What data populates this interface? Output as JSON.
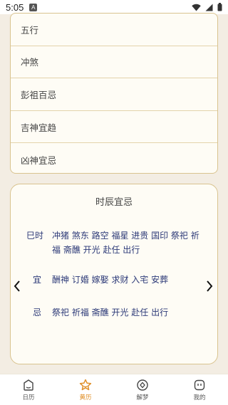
{
  "status_bar": {
    "time": "5:05",
    "notification_badge": "A"
  },
  "info_list": {
    "items": [
      {
        "label": "五行"
      },
      {
        "label": "冲煞"
      },
      {
        "label": "彭祖百忌"
      },
      {
        "label": "吉神宜趋"
      },
      {
        "label": "凶神宜忌"
      }
    ]
  },
  "shichen": {
    "title": "时辰宜忌",
    "hour_label": "巳时",
    "hour_text": "冲猪 煞东 路空 福星 进贵 国印 祭祀 祈福 斋醮 开光 赴任 出行",
    "yi_label": "宜",
    "yi_text": "酬神 订婚 嫁娶 求财 入宅 安葬",
    "ji_label": "忌",
    "ji_text": "祭祀 祈福 斋醮 开光 赴任 出行"
  },
  "tabs": [
    {
      "label": "日历",
      "icon": "calendar-icon",
      "active": false
    },
    {
      "label": "黄历",
      "icon": "star-icon",
      "active": true
    },
    {
      "label": "解梦",
      "icon": "dream-icon",
      "active": false
    },
    {
      "label": "我的",
      "icon": "profile-icon",
      "active": false
    }
  ],
  "colors": {
    "background": "#f3ede3",
    "card": "#fefcf5",
    "border": "#d9c38f",
    "accent": "#e0902a",
    "text_blue": "#2d3a78"
  }
}
